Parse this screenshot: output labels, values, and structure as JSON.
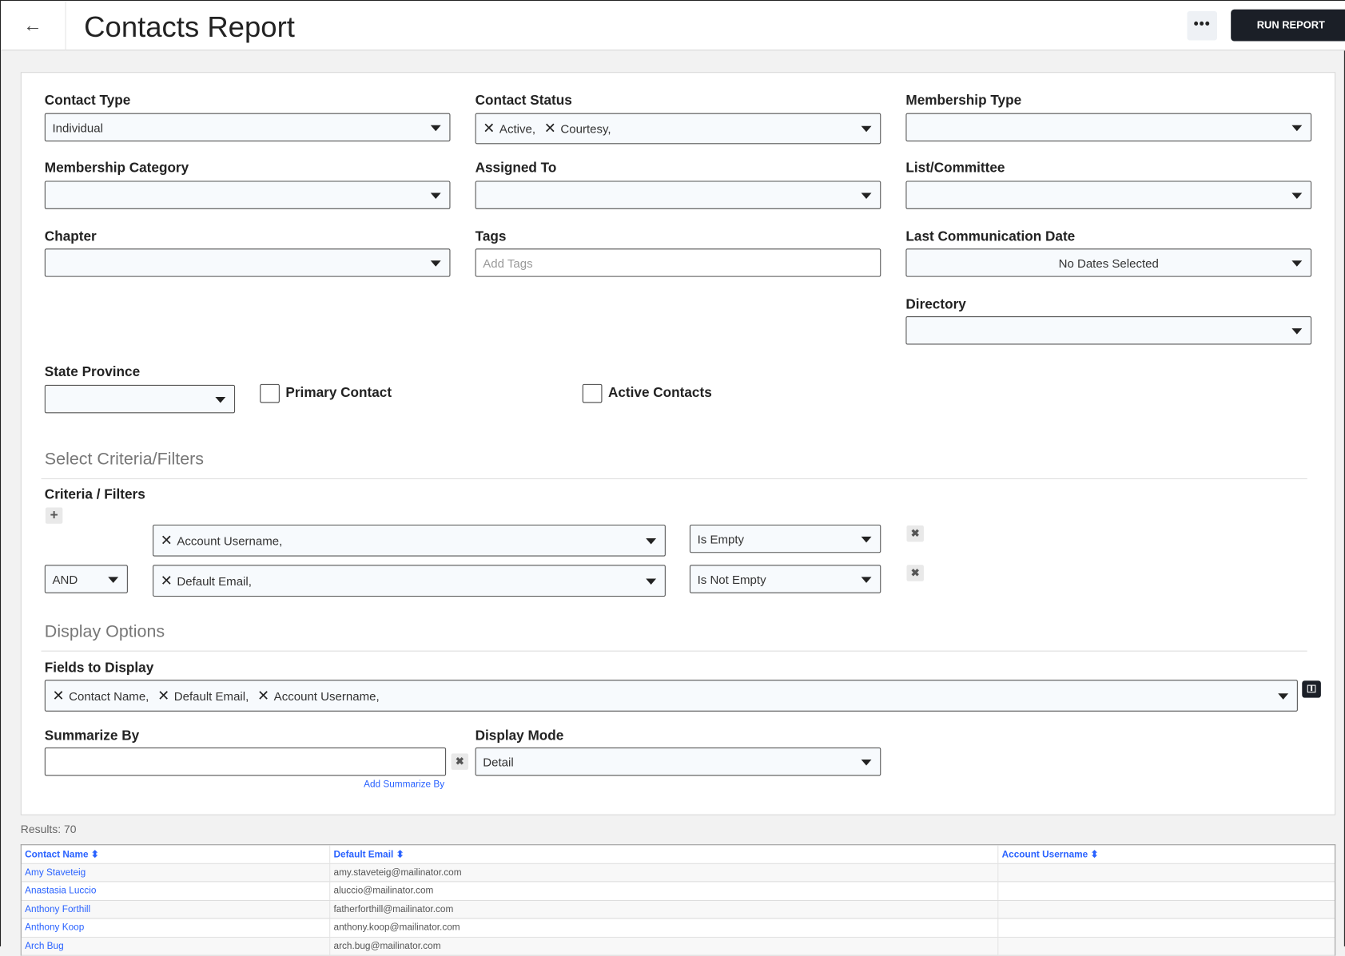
{
  "header": {
    "title": "Contacts Report",
    "back_icon": "arrow-left",
    "more_label": "•••",
    "run_label": "RUN REPORT"
  },
  "filters": {
    "contact_type": {
      "label": "Contact Type",
      "value": "Individual"
    },
    "contact_status": {
      "label": "Contact Status",
      "chips": [
        "Active,",
        "Courtesy,"
      ]
    },
    "membership_type": {
      "label": "Membership Type",
      "value": ""
    },
    "membership_category": {
      "label": "Membership Category",
      "value": ""
    },
    "assigned_to": {
      "label": "Assigned To",
      "value": ""
    },
    "list_committee": {
      "label": "List/Committee",
      "value": ""
    },
    "chapter": {
      "label": "Chapter",
      "value": ""
    },
    "tags": {
      "label": "Tags",
      "placeholder": "Add Tags"
    },
    "last_comm": {
      "label": "Last Communication Date",
      "value": "No Dates Selected"
    },
    "directory": {
      "label": "Directory",
      "value": ""
    },
    "state_province": {
      "label": "State Province",
      "value": ""
    },
    "primary_contact": {
      "label": "Primary Contact",
      "checked": false
    },
    "active_contacts": {
      "label": "Active Contacts",
      "checked": false
    }
  },
  "criteria": {
    "section_title": "Select Criteria/Filters",
    "label": "Criteria / Filters",
    "add_icon": "+",
    "rows": [
      {
        "conjunction": "",
        "field": "Account Username,",
        "operator": "Is Empty"
      },
      {
        "conjunction": "AND",
        "field": "Default Email,",
        "operator": "Is Not Empty"
      }
    ],
    "remove_icon": "✖"
  },
  "display": {
    "section_title": "Display Options",
    "fields_label": "Fields to Display",
    "fields": [
      "Contact Name,",
      "Default Email,",
      "Account Username,"
    ],
    "summarize_label": "Summarize By",
    "summarize_value": "",
    "add_summarize": "Add Summarize By",
    "mode_label": "Display Mode",
    "mode_value": "Detail"
  },
  "results": {
    "label": "Results: 70",
    "columns": [
      "Contact Name ⬍",
      "Default Email ⬍",
      "Account Username ⬍"
    ],
    "rows": [
      {
        "name": "Amy Staveteig",
        "email": "amy.staveteig@mailinator.com",
        "username": ""
      },
      {
        "name": "Anastasia Luccio",
        "email": "aluccio@mailinator.com",
        "username": ""
      },
      {
        "name": "Anthony Forthill",
        "email": "fatherforthill@mailinator.com",
        "username": ""
      },
      {
        "name": "Anthony Koop",
        "email": "anthony.koop@mailinator.com",
        "username": ""
      },
      {
        "name": "Arch Bug",
        "email": "arch.bug@mailinator.com",
        "username": ""
      }
    ]
  }
}
